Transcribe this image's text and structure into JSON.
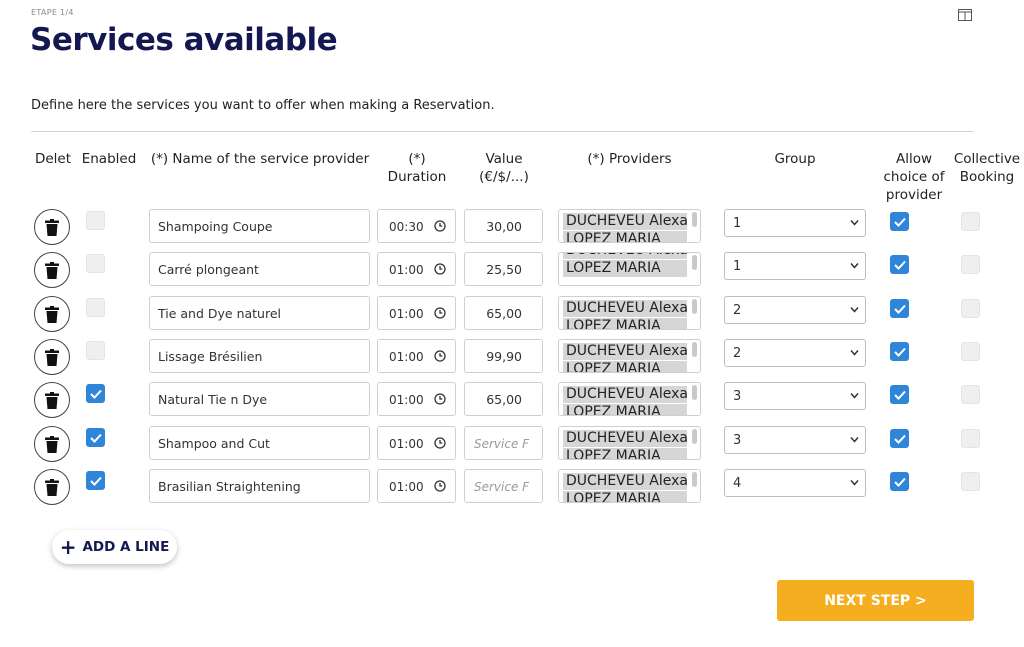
{
  "header": {
    "step": "ETAPE 1/4",
    "title": "Services available",
    "intro": "Define here the services you want to offer when making a Reservation."
  },
  "columns": {
    "delete": "Delet",
    "enabled": "Enabled",
    "name": "(*) Name of the service provider",
    "duration": "(*)\nDuration",
    "value": "Value\n(€/$/...)",
    "providers": "(*) Providers",
    "group": "Group",
    "allow": "Allow\nchoice of\nprovider",
    "collective": "Collective\nBooking"
  },
  "rows": [
    {
      "enabled": false,
      "name": "Shampoing   Coupe",
      "duration": "00:30",
      "value": "30,00",
      "providers": [
        "DUCHEVEU Alexa",
        "LOPEZ MARIA"
      ],
      "group": "1",
      "allow_choice": true,
      "collective": false
    },
    {
      "enabled": false,
      "name": "Carré plongeant",
      "duration": "01:00",
      "value": "25,50",
      "providers": [
        "DUCHEVEU Alexa",
        "LOPEZ MARIA"
      ],
      "group": "1",
      "allow_choice": true,
      "collective": false
    },
    {
      "enabled": false,
      "name": "Tie and Dye naturel",
      "duration": "01:00",
      "value": "65,00",
      "providers": [
        "DUCHEVEU Alexa",
        "LOPEZ MARIA"
      ],
      "group": "2",
      "allow_choice": true,
      "collective": false
    },
    {
      "enabled": false,
      "name": "Lissage Brésilien",
      "duration": "01:00",
      "value": "99,90",
      "providers": [
        "DUCHEVEU Alexa",
        "LOPEZ MARIA"
      ],
      "group": "2",
      "allow_choice": true,
      "collective": false
    },
    {
      "enabled": true,
      "name": "Natural Tie n Dye",
      "duration": "01:00",
      "value": "65,00",
      "providers": [
        "DUCHEVEU Alexa",
        "LOPEZ MARIA"
      ],
      "group": "3",
      "allow_choice": true,
      "collective": false
    },
    {
      "enabled": true,
      "name": "Shampoo and Cut",
      "duration": "01:00",
      "value": "",
      "providers": [
        "DUCHEVEU Alexa",
        "LOPEZ MARIA"
      ],
      "group": "3",
      "allow_choice": true,
      "collective": false
    },
    {
      "enabled": true,
      "name": "Brasilian Straightening",
      "duration": "01:00",
      "value": "",
      "providers": [
        "DUCHEVEU Alexa",
        "LOPEZ MARIA"
      ],
      "group": "4",
      "allow_choice": true,
      "collective": false
    }
  ],
  "providers_scroll_offset": [
    0,
    1,
    0,
    0,
    0,
    0,
    0
  ],
  "value_placeholder": "Service F",
  "buttons": {
    "add_line": "ADD A LINE",
    "next_step": "NEXT STEP >"
  },
  "colors": {
    "title": "#141850",
    "checkbox_checked": "#2f86d9",
    "next_button": "#f5ae1f"
  },
  "icons": [
    "layout-icon",
    "trash-icon",
    "clock-icon",
    "chevron-down-icon",
    "check-icon",
    "plus-icon"
  ]
}
